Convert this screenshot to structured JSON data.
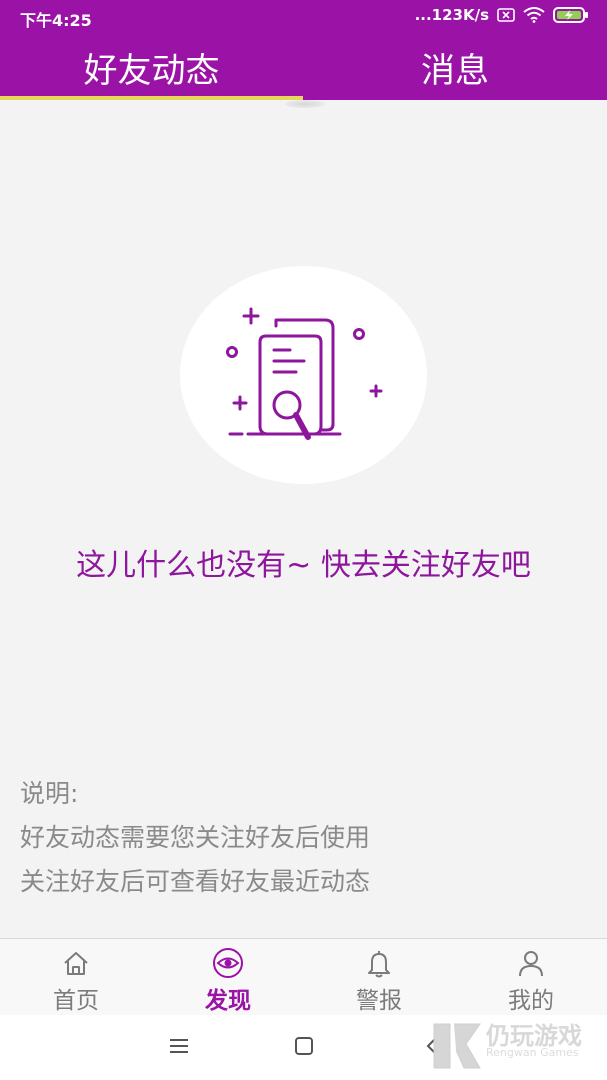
{
  "status_bar": {
    "time": "下午4:25",
    "network_speed": "...123K/s",
    "icons": [
      "sim-icon",
      "wifi-icon",
      "battery-charging-icon"
    ]
  },
  "tabs": [
    {
      "label": "好友动态",
      "selected": true
    },
    {
      "label": "消息",
      "selected": false
    }
  ],
  "empty_state": {
    "icon": "document-search-icon",
    "message": "这儿什么也没有~ 快去关注好友吧"
  },
  "note": {
    "title": "说明:",
    "lines": [
      "好友动态需要您关注好友后使用",
      "关注好友后可查看好友最近动态"
    ]
  },
  "bottom_nav": [
    {
      "label": "首页",
      "icon": "home-icon",
      "active": false
    },
    {
      "label": "发现",
      "icon": "eye-icon",
      "active": true
    },
    {
      "label": "警报",
      "icon": "bell-icon",
      "active": false
    },
    {
      "label": "我的",
      "icon": "user-icon",
      "active": false
    }
  ],
  "system_nav": [
    "menu-icon",
    "home-square-icon",
    "back-icon"
  ],
  "watermark": {
    "cn": "仍玩游戏",
    "en": "Rengwan Games"
  },
  "colors": {
    "brand_purple": "#9a12a6",
    "accent_purple": "#8d169d",
    "tab_indicator": "#e8d65a",
    "background": "#f3f3f3"
  }
}
